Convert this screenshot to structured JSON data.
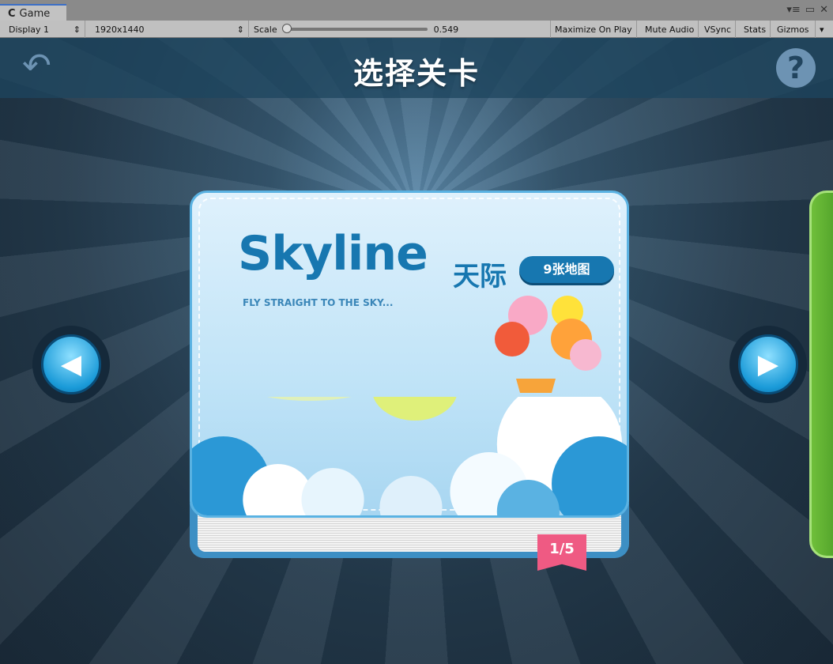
{
  "window": {
    "tab_label": "Game",
    "icons": [
      "unity-logo-icon",
      "tab-menu-icon",
      "maximize-icon",
      "close-icon"
    ]
  },
  "toolbar": {
    "display": "Display 1",
    "resolution": "1920x1440",
    "scale_label": "Scale",
    "scale_value": "0.549",
    "scale_fraction": 0.549,
    "maximize_on_play": "Maximize On Play",
    "mute_audio": "Mute Audio",
    "vsync": "VSync",
    "stats": "Stats",
    "gizmos": "Gizmos"
  },
  "game": {
    "title": "选择关卡",
    "back_icon": "back-arrow-icon",
    "help_icon": "question-mark-icon",
    "help_text": "?",
    "book": {
      "title": "Skyline",
      "title_cn": "天际",
      "maps_badge": "9张地图",
      "tagline": "FLY STRAIGHT TO THE SKY...",
      "page_indicator": "1/5"
    },
    "colors": {
      "accent": "#1777b0",
      "ribbon": "#ef5a83",
      "next_book": "#5aaa2e"
    }
  }
}
